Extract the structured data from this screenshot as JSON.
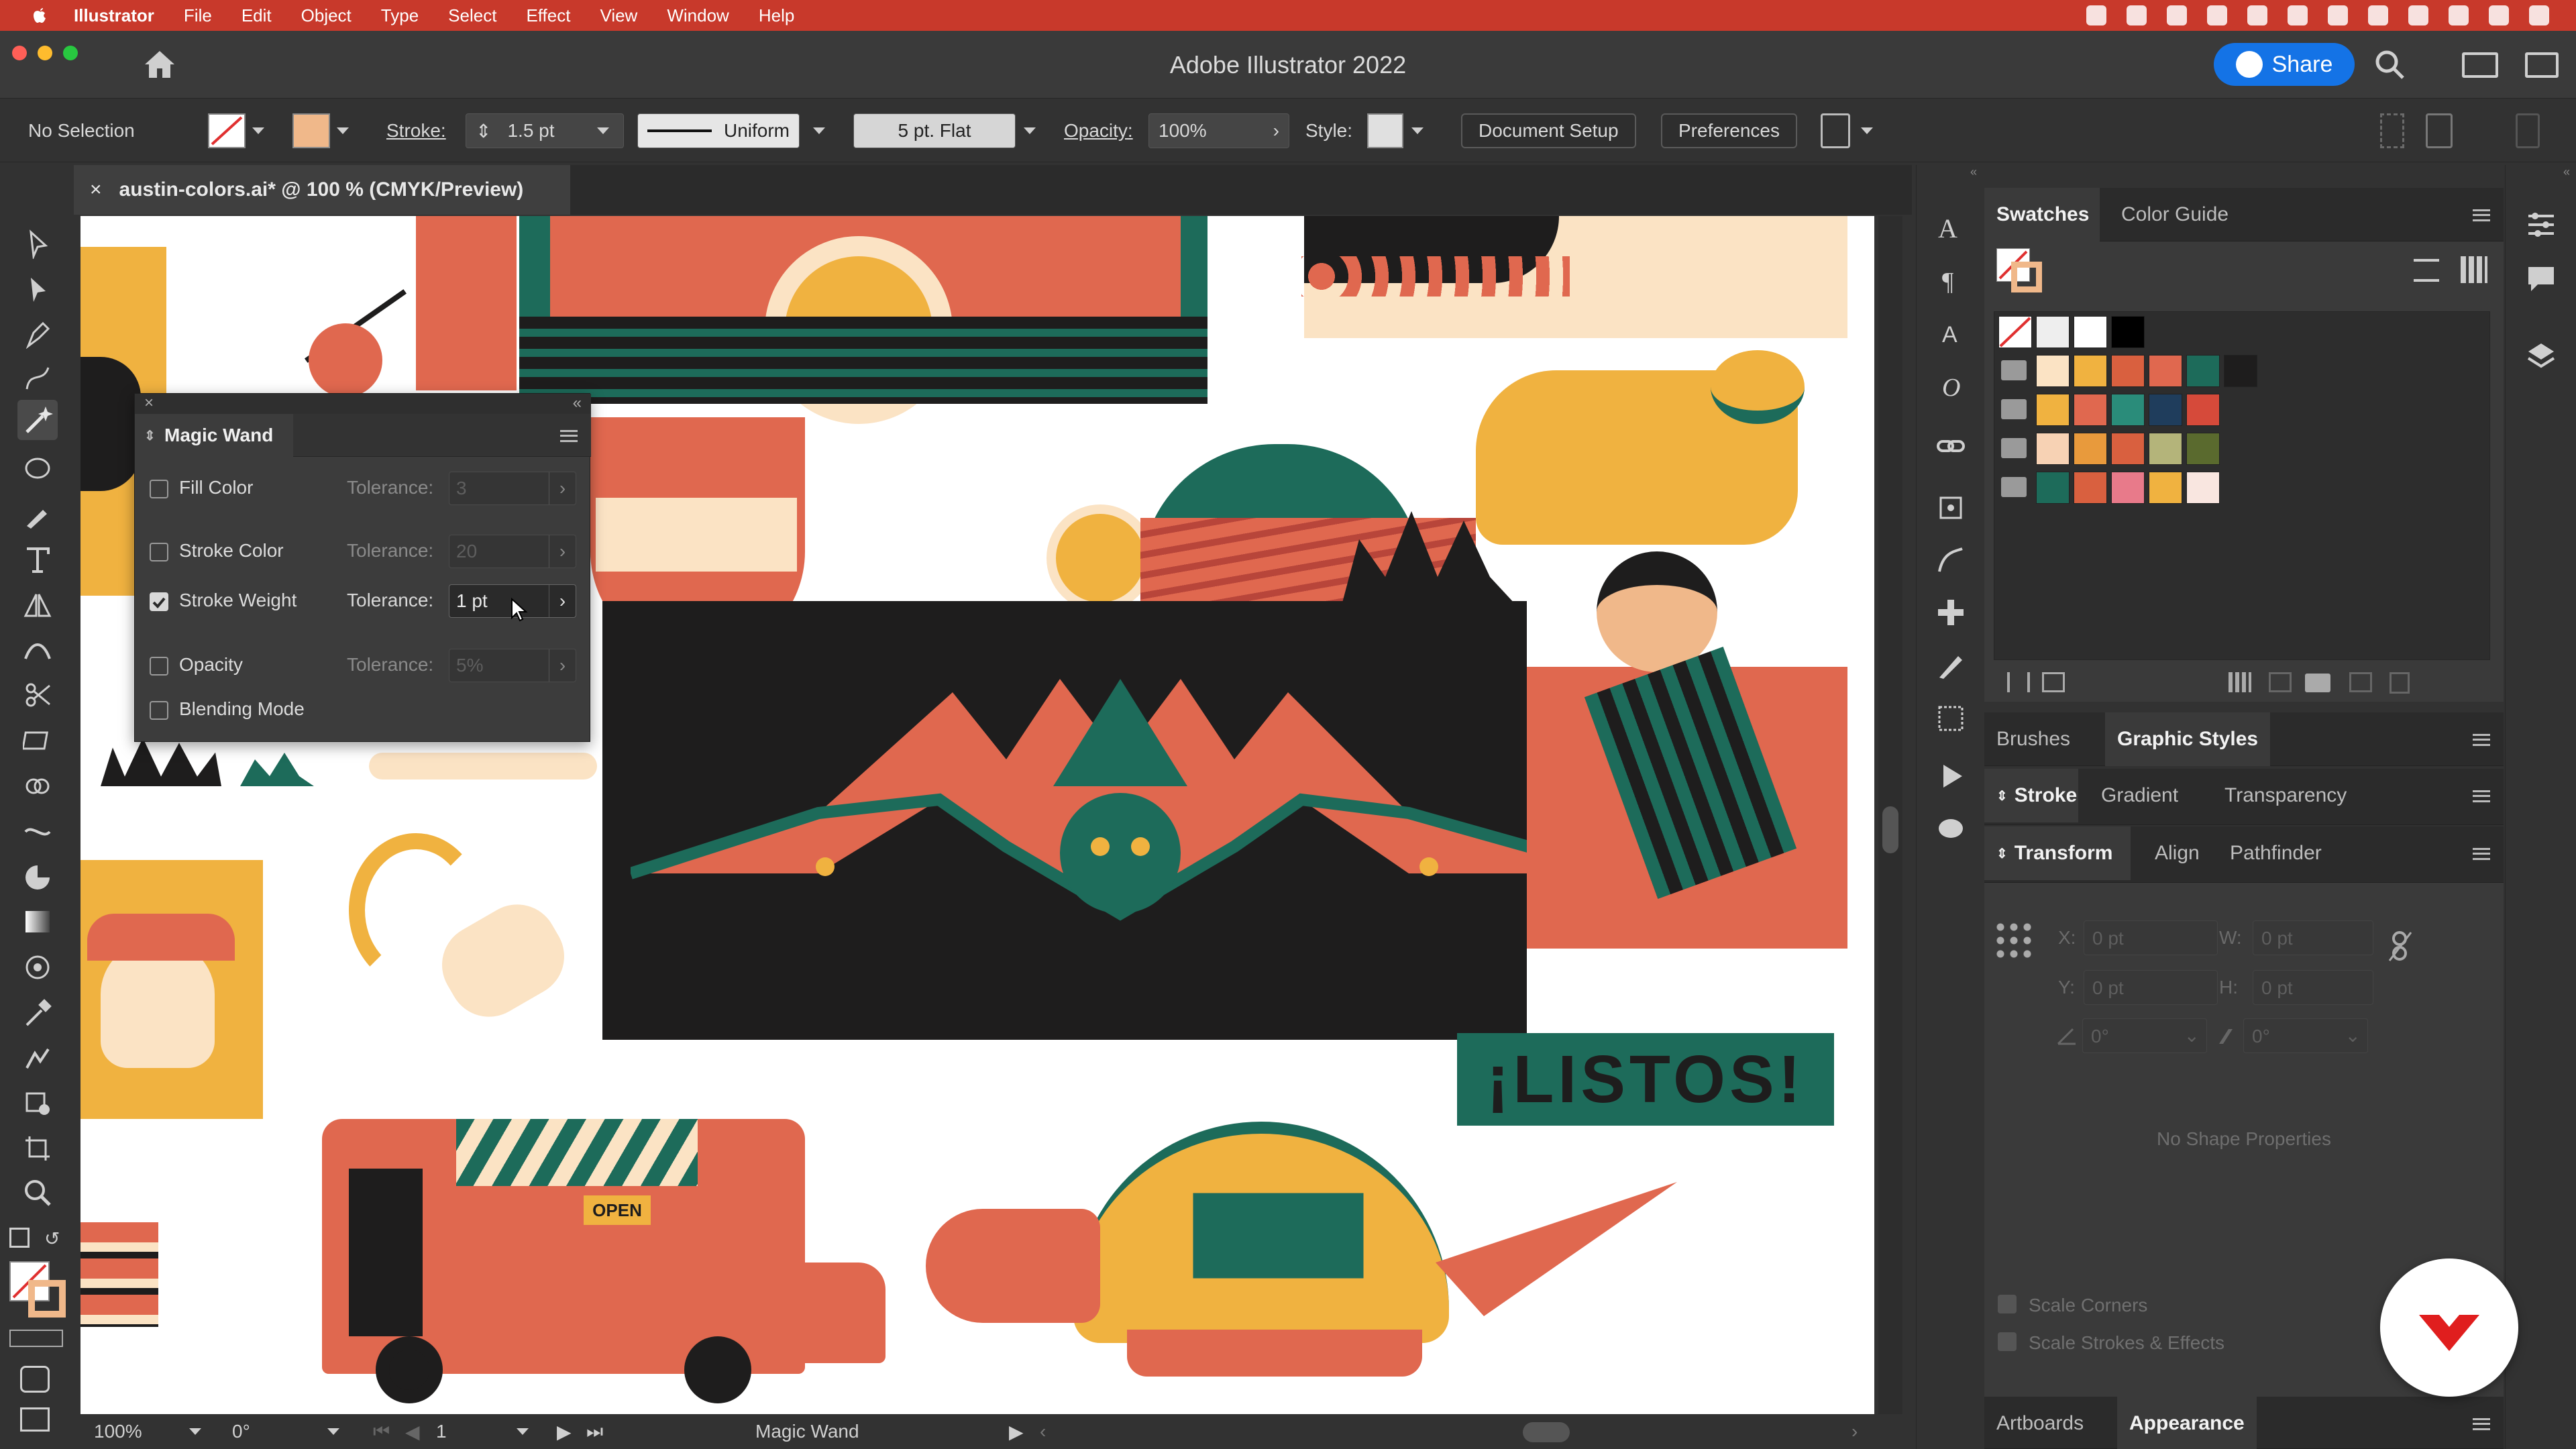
{
  "menubar": {
    "app_name": "Illustrator",
    "items": [
      "File",
      "Edit",
      "Object",
      "Type",
      "Select",
      "Effect",
      "View",
      "Window",
      "Help"
    ]
  },
  "titlebar": {
    "title": "Adobe Illustrator 2022",
    "share_label": "Share"
  },
  "controlbar": {
    "selection_status": "No Selection",
    "stroke_label": "Stroke:",
    "stroke_weight": "1.5 pt",
    "profile": "Uniform",
    "brush": "5 pt. Flat",
    "opacity_label": "Opacity:",
    "opacity_value": "100%",
    "style_label": "Style:",
    "document_setup_label": "Document Setup",
    "preferences_label": "Preferences"
  },
  "document_tab": {
    "close_glyph": "×",
    "title": "austin-colors.ai* @ 100 % (CMYK/Preview)"
  },
  "magic_wand": {
    "title": "Magic Wand",
    "tolerance_label": "Tolerance:",
    "rows": [
      {
        "label": "Fill Color",
        "checked": false,
        "tolerance": "3"
      },
      {
        "label": "Stroke Color",
        "checked": false,
        "tolerance": "20"
      },
      {
        "label": "Stroke Weight",
        "checked": true,
        "tolerance": "1 pt"
      },
      {
        "label": "Opacity",
        "checked": false,
        "tolerance": "5%"
      },
      {
        "label": "Blending Mode",
        "checked": false
      }
    ]
  },
  "canvas_art": {
    "sign_text": "¡LISTOS!",
    "truck_sign": "OPEN"
  },
  "panels": {
    "top_tabs": [
      "Swatches",
      "Color Guide"
    ],
    "mid_tabs": [
      "Brushes",
      "Graphic Styles"
    ],
    "stroke_tabs": [
      "Stroke",
      "Gradient",
      "Transparency"
    ],
    "transform_tabs": [
      "Transform",
      "Align",
      "Pathfinder"
    ],
    "transform": {
      "x_label": "X:",
      "x_value": "0 pt",
      "y_label": "Y:",
      "y_value": "0 pt",
      "w_label": "W:",
      "w_value": "0 pt",
      "h_label": "H:",
      "h_value": "0 pt",
      "angle_value": "0°",
      "shear_value": "0°"
    },
    "no_shape": "No Shape Properties",
    "scale_corners": "Scale Corners",
    "scale_strokes": "Scale Strokes & Effects",
    "bottom_tabs": [
      "Artboards",
      "Appearance"
    ]
  },
  "statusbar": {
    "zoom": "100%",
    "rotation": "0°",
    "artboard": "1",
    "tool": "Magic Wand"
  },
  "colors": {
    "menubar": "#c8392b",
    "accent_blue": "#1473e6",
    "art_orange": "#e0684f",
    "art_yellow": "#f0b240",
    "art_green": "#1d6b5a",
    "art_black": "#1e1d1d",
    "art_cream": "#fbe3c4"
  }
}
